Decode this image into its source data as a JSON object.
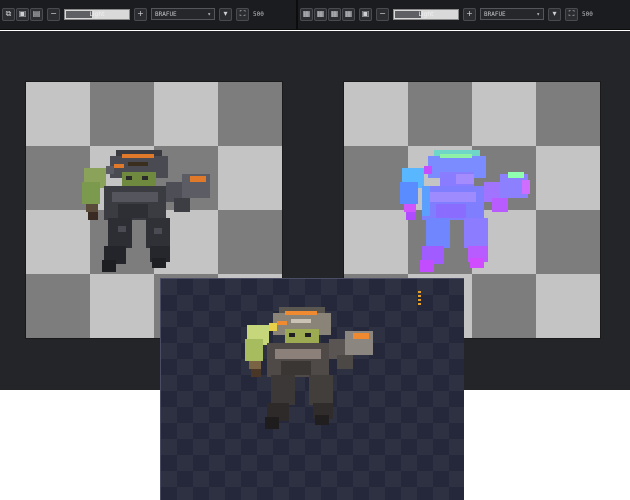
{
  "toolbar_left": {
    "tool_icons": [
      "select-icon",
      "copy-icon",
      "paste-icon"
    ],
    "slider_label": "Light",
    "select_value": "BRAFUE",
    "readout": "500"
  },
  "toolbar_right": {
    "tool_icons": [
      "grid-icon",
      "grid-icon",
      "grid-icon",
      "grid-icon"
    ],
    "slider_label": "Light",
    "select_value": "BRAFUE",
    "readout": "500"
  },
  "panels": {
    "left": {
      "content": "diffuse-sprite"
    },
    "right": {
      "content": "normal-map-sprite"
    }
  },
  "preview": {
    "content": "lit-sprite-preview"
  },
  "colors": {
    "toolbar_bg": "#1b1c1f",
    "editor_bg": "#242529",
    "checker_light": "#c4c4c4",
    "checker_dark": "#7d7d7d",
    "preview_bg": "#2e3142",
    "accent_orange": "#e6a328"
  }
}
